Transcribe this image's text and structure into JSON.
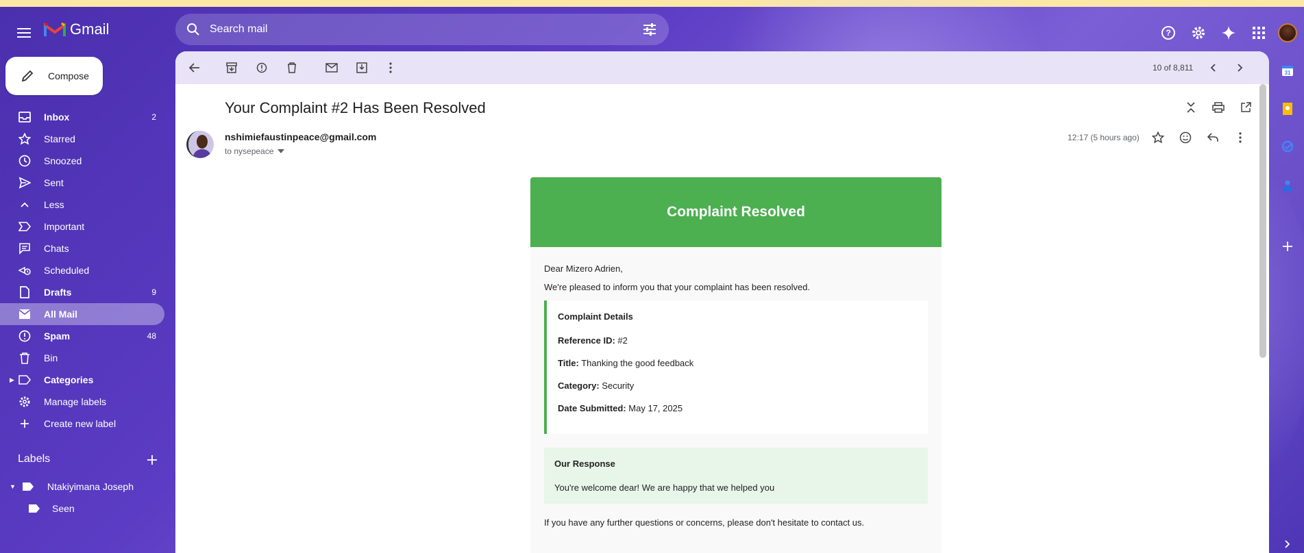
{
  "app": {
    "name": "Gmail"
  },
  "header": {
    "search_placeholder": "Search mail"
  },
  "compose": {
    "label": "Compose"
  },
  "sidebar": {
    "items": [
      {
        "label": "Inbox",
        "count": "2",
        "icon": "inbox-icon",
        "bold": true
      },
      {
        "label": "Starred",
        "count": "",
        "icon": "star-icon"
      },
      {
        "label": "Snoozed",
        "count": "",
        "icon": "clock-icon"
      },
      {
        "label": "Sent",
        "count": "",
        "icon": "send-icon"
      },
      {
        "label": "Less",
        "count": "",
        "icon": "chevron-up-icon"
      },
      {
        "label": "Important",
        "count": "",
        "icon": "important-icon"
      },
      {
        "label": "Chats",
        "count": "",
        "icon": "chat-icon"
      },
      {
        "label": "Scheduled",
        "count": "",
        "icon": "scheduled-icon"
      },
      {
        "label": "Drafts",
        "count": "9",
        "icon": "draft-icon",
        "bold": true
      },
      {
        "label": "All Mail",
        "count": "",
        "icon": "all-mail-icon",
        "bold": true,
        "active": true
      },
      {
        "label": "Spam",
        "count": "48",
        "icon": "spam-icon",
        "bold": true
      },
      {
        "label": "Bin",
        "count": "",
        "icon": "bin-icon"
      },
      {
        "label": "Categories",
        "count": "",
        "icon": "label-icon",
        "bold": true
      },
      {
        "label": "Manage labels",
        "count": "",
        "icon": "gear-icon"
      },
      {
        "label": "Create new label",
        "count": "",
        "icon": "plus-icon"
      }
    ],
    "labels_heading": "Labels",
    "labels": [
      {
        "label": "Ntakiyimana Joseph"
      },
      {
        "label": "Seen"
      }
    ]
  },
  "toolbar": {
    "count_text": "10 of 8,811"
  },
  "email": {
    "subject": "Your Complaint #2 Has Been Resolved",
    "sender": "nshimiefaustinpeace@gmail.com",
    "to": "to nysepeace",
    "time": "12:17 (5 hours ago)",
    "card_title": "Complaint Resolved",
    "greeting": "Dear Mizero Adrien,",
    "intro": "We're pleased to inform you that your complaint has been resolved.",
    "details_heading": "Complaint Details",
    "details": [
      {
        "key": "Reference ID:",
        "value": " #2"
      },
      {
        "key": "Title:",
        "value": " Thanking the good feedback"
      },
      {
        "key": "Category:",
        "value": " Security"
      },
      {
        "key": "Date Submitted:",
        "value": " May 17, 2025"
      }
    ],
    "response_heading": "Our Response",
    "response_text": "You're welcome dear! We are happy that we helped you",
    "footer": "If you have any further questions or concerns, please don't hesitate to contact us."
  },
  "colors": {
    "accent_green": "#4caf50",
    "gmail_red": "#ea4335"
  }
}
